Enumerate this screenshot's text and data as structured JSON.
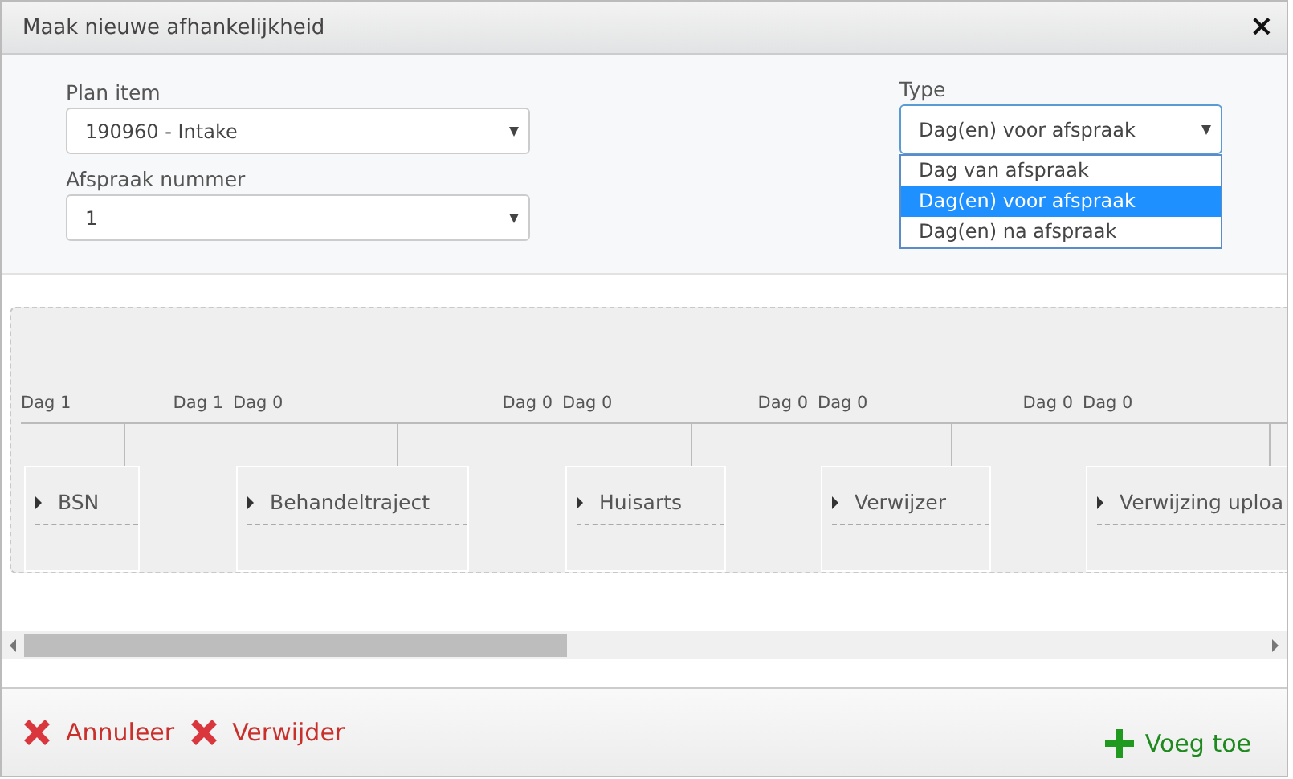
{
  "dialog": {
    "title": "Maak nieuwe afhankelijkheid",
    "close": "×"
  },
  "form": {
    "plan_item": {
      "label": "Plan item",
      "value": "190960 - Intake"
    },
    "afspraak_nummer": {
      "label": "Afspraak nummer",
      "value": "1"
    },
    "type": {
      "label": "Type",
      "value": "Dag(en) voor afspraak",
      "expanded": true,
      "options": [
        {
          "label": "Dag van afspraak",
          "selected": false
        },
        {
          "label": "Dag(en) voor afspraak",
          "selected": true
        },
        {
          "label": "Dag(en) na afspraak",
          "selected": false
        }
      ]
    }
  },
  "timeline": {
    "nodes": [
      {
        "label": "BSN",
        "start": "Dag 1",
        "end": "Dag 1"
      },
      {
        "label": "Behandeltraject",
        "start": "Dag 0",
        "end": "Dag 0"
      },
      {
        "label": "Huisarts",
        "start": "Dag 0",
        "end": "Dag 0"
      },
      {
        "label": "Verwijzer",
        "start": "Dag 0",
        "end": "Dag 0"
      },
      {
        "label": "Verwijzing uploa",
        "start": "Dag 0"
      }
    ]
  },
  "footer": {
    "buttons": [
      {
        "label": "Annuleer",
        "kind": "cancel"
      },
      {
        "label": "Verwijder",
        "kind": "delete"
      },
      {
        "label": "Voeg toe",
        "kind": "add"
      }
    ]
  }
}
